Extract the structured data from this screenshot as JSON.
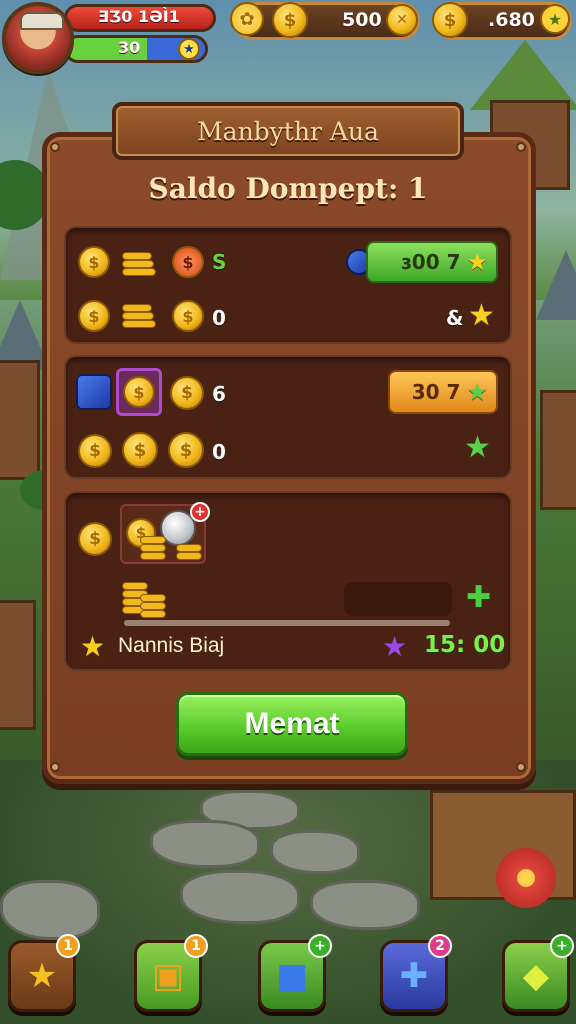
{
  "hud": {
    "hp_text": "ƎƷ0 1ƏÌ1",
    "xp_text": "30",
    "currency_left": "500",
    "currency_right": ".680"
  },
  "panel": {
    "title": "Manbythr Aua",
    "heading": "Saldo Dompept: 1"
  },
  "section1": {
    "row1_value": "S",
    "row1_button": "ɜ00 7",
    "row2_value": "0",
    "row2_side": "&"
  },
  "section2": {
    "row1_value": "6",
    "row1_button": "30 7",
    "row2_value": "0"
  },
  "section3": {
    "badge": "+",
    "name": "Nannis Biaj",
    "timer": "15: 00"
  },
  "action_button": "Memat",
  "bottom_bar": {
    "badges": [
      "1",
      "1",
      "+",
      "2",
      "+"
    ]
  },
  "colors": {
    "panel_bg": "#7a3e22",
    "accent_green": "#5ccc2c",
    "accent_orange": "#e08a1a",
    "coin_gold": "#f2b81c"
  }
}
